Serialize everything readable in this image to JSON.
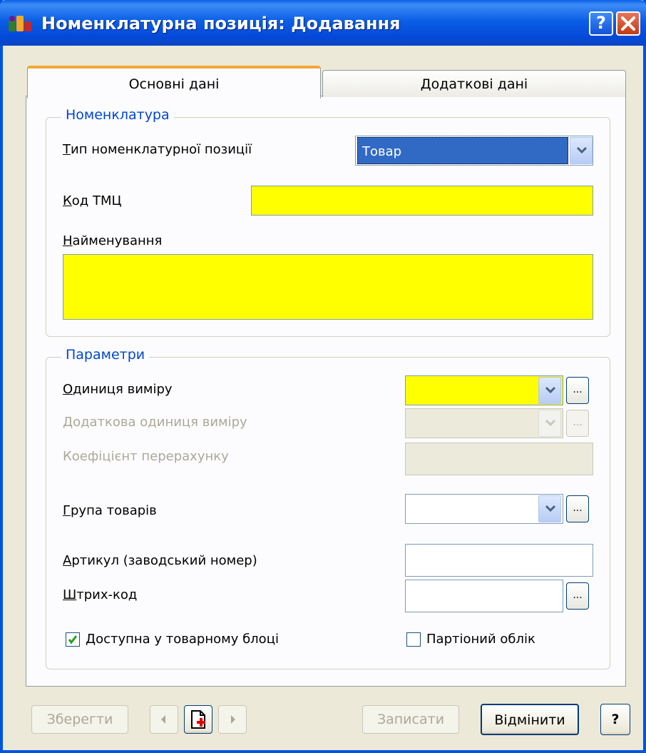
{
  "window": {
    "title": "Номенклатурна позиція: Додавання",
    "help_label": "?",
    "close_label": "✕"
  },
  "tabs": [
    {
      "label": "Основні дані",
      "active": true
    },
    {
      "label": "Додаткові дані",
      "active": false
    }
  ],
  "nomenclature": {
    "legend": "Номенклатура",
    "type_label": "Тип номенклатурної позиції",
    "type_value": "Товар",
    "code_label": "Код ТМЦ",
    "code_value": "",
    "name_label": "Найменування",
    "name_value": ""
  },
  "parameters": {
    "legend": "Параметри",
    "unit_label": "Одиниця виміру",
    "unit_value": "",
    "extra_unit_label": "Додаткова одиниця виміру",
    "coef_label": "Коефіцієнт перерахунку",
    "group_label": "Група товарів",
    "group_value": "",
    "article_label": "Артикул (заводський номер)",
    "article_value": "",
    "barcode_label": "Штрих-код",
    "barcode_value": "",
    "ellipsis": "...",
    "available_label": "Доступна у товарному блоці",
    "available_checked": true,
    "batch_label": "Партіоний облік",
    "batch_checked": false
  },
  "buttons": {
    "save": "Зберегти",
    "record": "Записати",
    "cancel": "Відмінити",
    "help": "?"
  },
  "colors": {
    "required_field": "#ffff00",
    "accent_blue": "#0046d5",
    "title_bar": "#0054e3"
  }
}
